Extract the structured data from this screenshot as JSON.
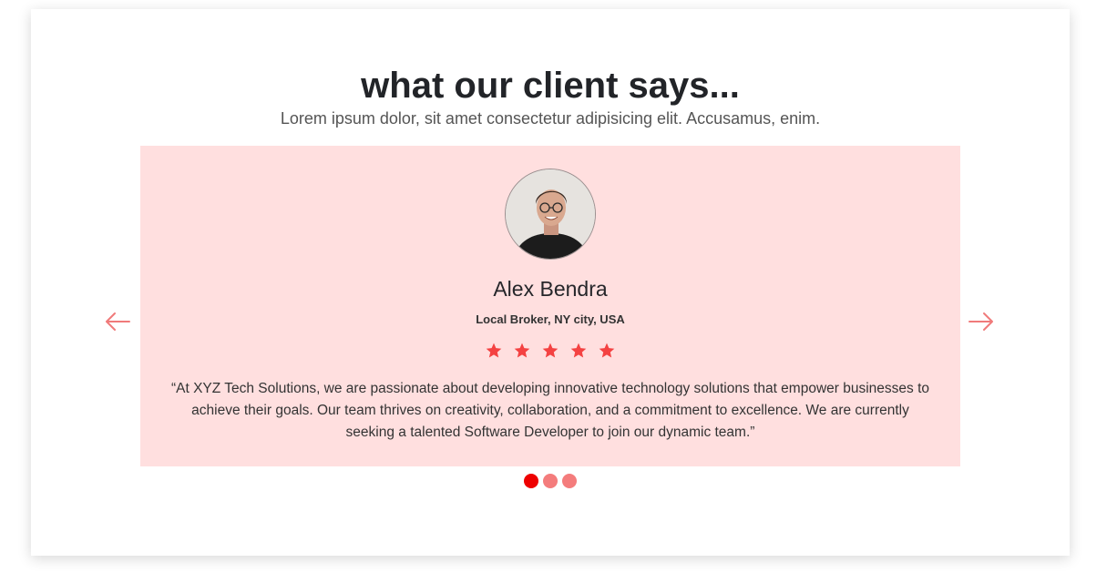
{
  "section": {
    "title": "what our client says...",
    "subtitle": "Lorem ipsum dolor, sit amet consectetur adipisicing elit. Accusamus, enim."
  },
  "testimonial": {
    "name": "Alex Bendra",
    "role": "Local Broker, NY city, USA",
    "rating": 5,
    "quote": "“At XYZ Tech Solutions, we are passionate about developing innovative technology solutions that empower businesses to achieve their goals. Our team thrives on creativity, collaboration, and a commitment to excellence. We are currently seeking a talented Software Developer to join our dynamic team.”",
    "avatar_icon": "person-photo"
  },
  "carousel": {
    "prev_icon": "arrow-left-icon",
    "next_icon": "arrow-right-icon",
    "slide_count": 3,
    "active_index": 0
  },
  "colors": {
    "slide_bg": "#ffdfdf",
    "star": "#f44242",
    "arrow": "#f07a7a",
    "dot_active": "#ee0000",
    "dot_inactive": "#f47c7c"
  }
}
